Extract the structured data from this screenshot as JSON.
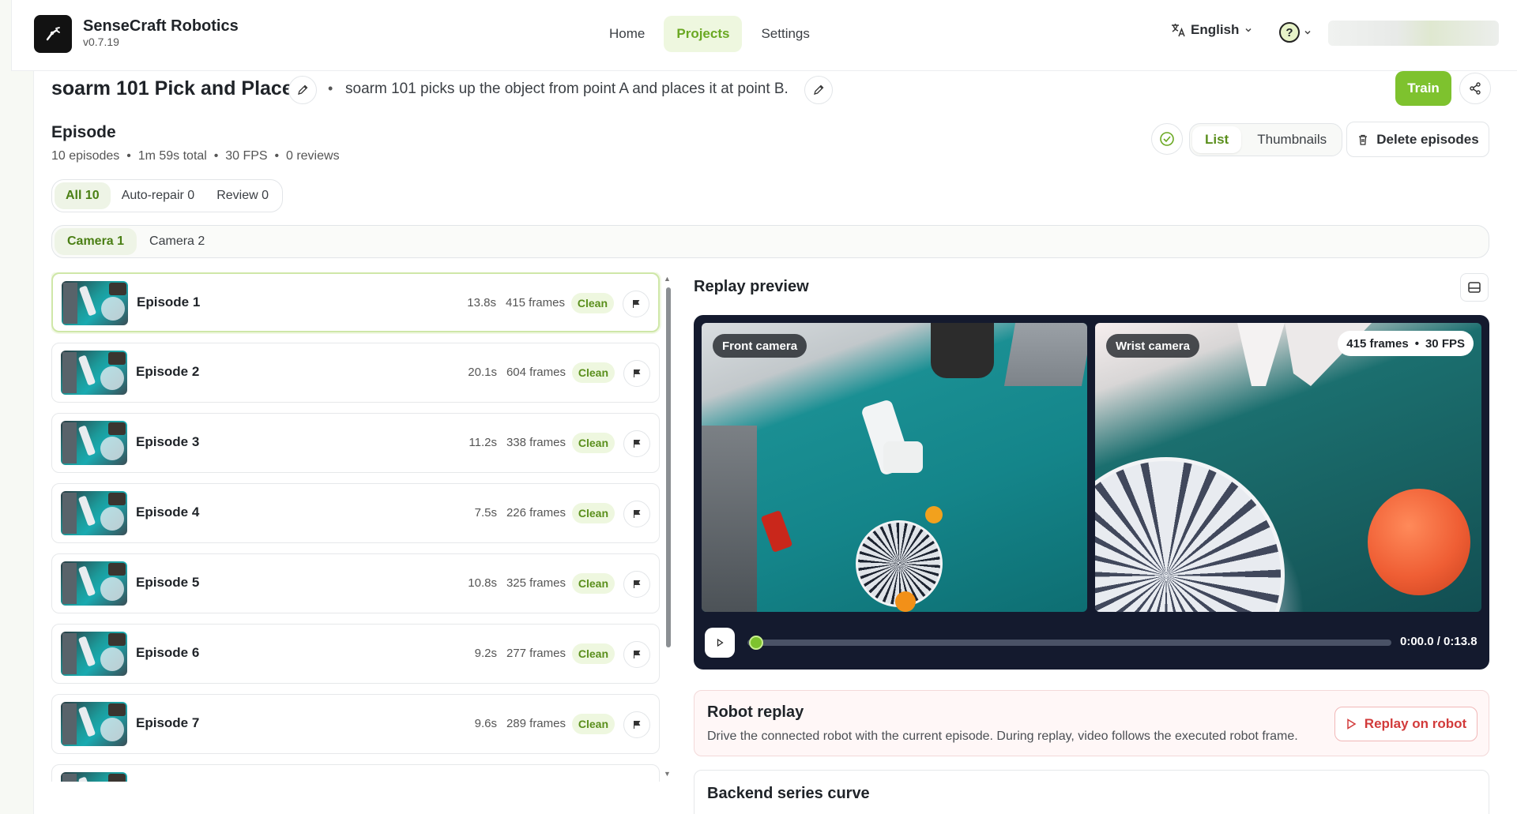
{
  "app": {
    "name": "SenseCraft Robotics",
    "version": "v0.7.19"
  },
  "nav": {
    "items": [
      "Home",
      "Projects",
      "Settings"
    ],
    "active": "Projects"
  },
  "language": {
    "label": "English"
  },
  "project": {
    "title": "soarm 101 Pick and Place1",
    "description": "soarm 101 picks up the object from point A and places it at point B.",
    "train_label": "Train"
  },
  "episodes_section": {
    "title": "Episode",
    "meta": [
      "10 episodes",
      "1m 59s total",
      "30 FPS",
      "0 reviews"
    ],
    "view_options": [
      "List",
      "Thumbnails"
    ],
    "view_active": "List",
    "delete_label": "Delete episodes",
    "filters": [
      "All 10",
      "Auto-repair 0",
      "Review 0"
    ],
    "filter_active": "All 10",
    "cameras": [
      "Camera 1",
      "Camera 2"
    ],
    "camera_active": "Camera 1"
  },
  "episodes": [
    {
      "name": "Episode 1",
      "duration": "13.8s",
      "frames": "415 frames",
      "status": "Clean"
    },
    {
      "name": "Episode 2",
      "duration": "20.1s",
      "frames": "604 frames",
      "status": "Clean"
    },
    {
      "name": "Episode 3",
      "duration": "11.2s",
      "frames": "338 frames",
      "status": "Clean"
    },
    {
      "name": "Episode 4",
      "duration": "7.5s",
      "frames": "226 frames",
      "status": "Clean"
    },
    {
      "name": "Episode 5",
      "duration": "10.8s",
      "frames": "325 frames",
      "status": "Clean"
    },
    {
      "name": "Episode 6",
      "duration": "9.2s",
      "frames": "277 frames",
      "status": "Clean"
    },
    {
      "name": "Episode 7",
      "duration": "9.6s",
      "frames": "289 frames",
      "status": "Clean"
    }
  ],
  "preview": {
    "title": "Replay preview",
    "front_label": "Front camera",
    "wrist_label": "Wrist camera",
    "frames_info": "415 frames",
    "fps_info": "30 FPS",
    "time": "0:00.0 / 0:13.8",
    "progress": 0.0
  },
  "robot_replay": {
    "title": "Robot replay",
    "description": "Drive the connected robot with the current episode. During replay, video follows the executed robot frame.",
    "button_label": "Replay on robot"
  },
  "backend": {
    "title": "Backend series curve"
  },
  "colors": {
    "accent": "#7ec22e",
    "danger": "#d23b3b",
    "player_bg": "#141a2e"
  }
}
